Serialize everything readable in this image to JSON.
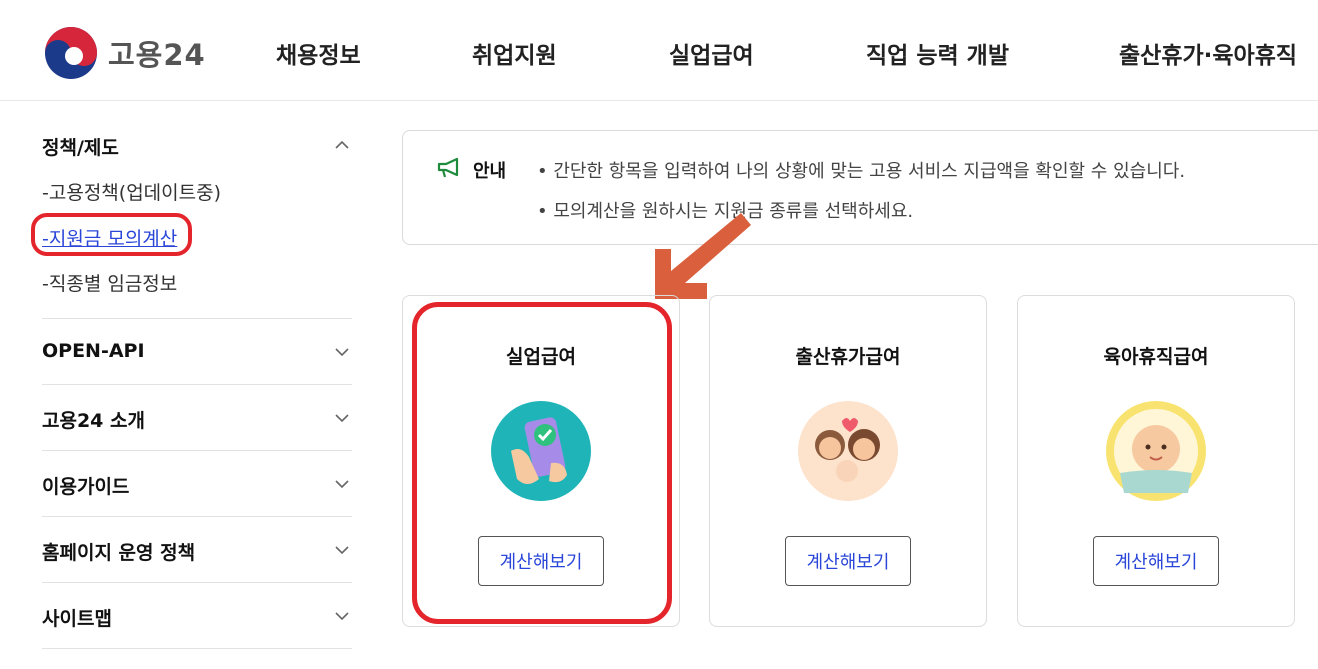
{
  "header": {
    "logo_text": "고용24",
    "nav": [
      "채용정보",
      "취업지원",
      "실업급여",
      "직업 능력 개발",
      "출산휴가·육아휴직"
    ]
  },
  "sidebar": {
    "groups": [
      {
        "title": "정책/제도",
        "expanded": true,
        "items": [
          {
            "label": "-고용정책(업데이트중)",
            "active": false
          },
          {
            "label": "-지원금 모의계산",
            "active": true
          },
          {
            "label": "-직종별 임금정보",
            "active": false
          }
        ]
      },
      {
        "title": "OPEN-API",
        "expanded": false
      },
      {
        "title": "고용24 소개",
        "expanded": false
      },
      {
        "title": "이용가이드",
        "expanded": false
      },
      {
        "title": "홈페이지 운영 정책",
        "expanded": false
      },
      {
        "title": "사이트맵",
        "expanded": false
      }
    ]
  },
  "notice": {
    "label": "안내",
    "lines": [
      "• 간단한 항목을 입력하여 나의 상황에 맞는 고용 서비스 지급액을 확인할 수 있습니다.",
      "• 모의계산을 원하시는 지원금 종류를 선택하세요."
    ]
  },
  "cards": [
    {
      "title": "실업급여",
      "button": "계산해보기",
      "icon": "phone-check-icon",
      "bg": "#1fb5b8"
    },
    {
      "title": "출산휴가급여",
      "button": "계산해보기",
      "icon": "family-icon",
      "bg": "#fde2cc"
    },
    {
      "title": "육아휴직급여",
      "button": "계산해보기",
      "icon": "baby-icon",
      "bg": "#f9e370"
    }
  ],
  "colors": {
    "accent_link": "#2a46d9",
    "highlight": "#e4262c",
    "arrow": "#d95f3d"
  }
}
